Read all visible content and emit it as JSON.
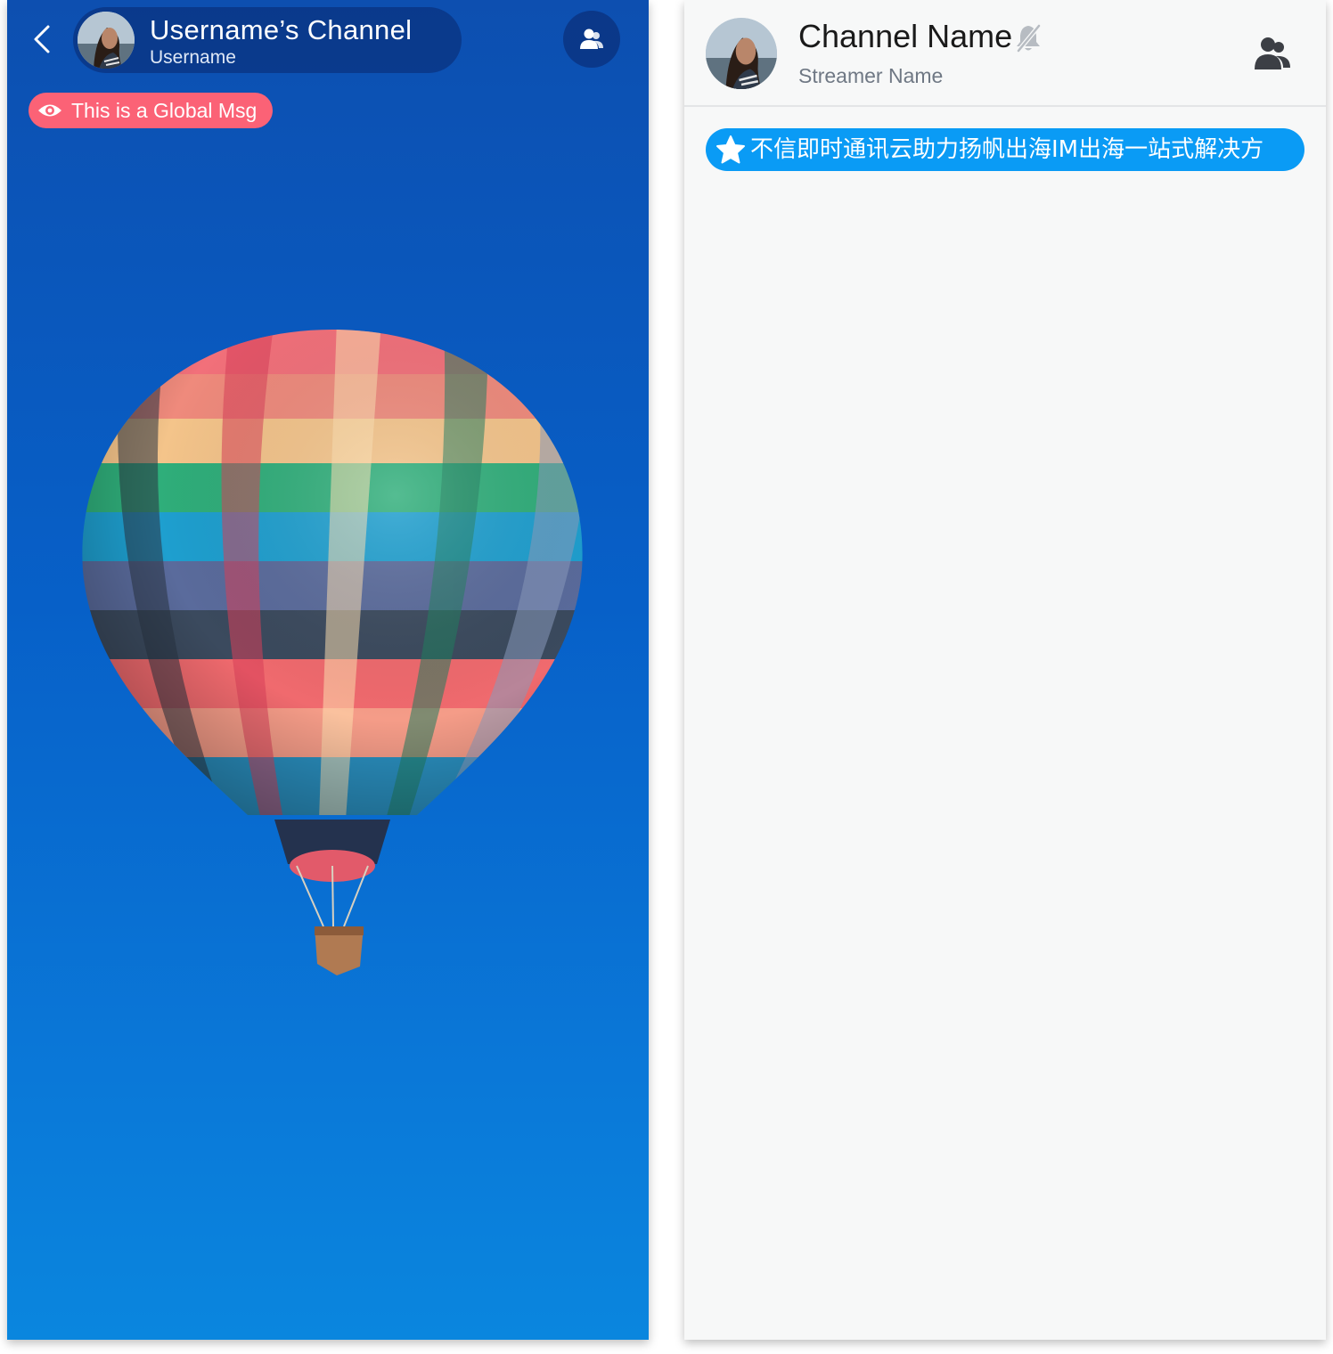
{
  "left_screen": {
    "header": {
      "back_icon": "chevron-left-icon",
      "channel_title": "Username’s Channel",
      "channel_subtitle": "Username",
      "members_icon": "members-icon"
    },
    "global_message": {
      "icon": "eye-icon",
      "text": "This is a Global Msg",
      "color": "#fb6276"
    },
    "background_image": "hot-air-balloon",
    "background_color": "#0760c8"
  },
  "right_screen": {
    "header": {
      "channel_name": "Channel Name",
      "mute_icon": "bell-off-icon",
      "streamer_name": "Streamer Name",
      "members_icon": "members-icon"
    },
    "notice": {
      "icon": "star-icon",
      "text": "不信即时通讯云助力扬帆出海IM出海一站式解决方",
      "color": "#0a9bf5"
    },
    "background_color": "#f7f8f8"
  }
}
